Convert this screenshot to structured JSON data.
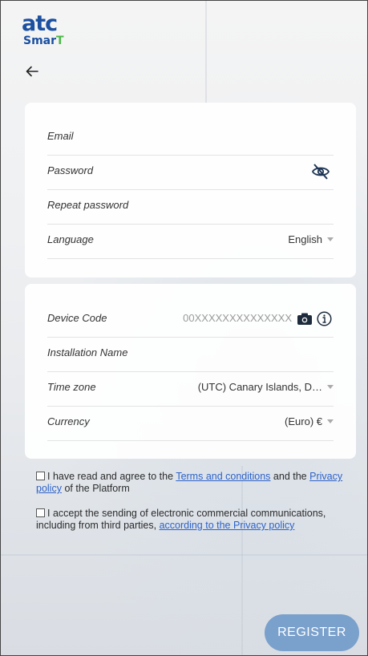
{
  "logo": {
    "atc": "atc",
    "smart_part1": "Smar",
    "smart_part2": "T",
    "brand_color": "#1b4fa0",
    "accent_color": "#4cb848"
  },
  "account_form": {
    "email_label": "Email",
    "password_label": "Password",
    "password_icon": "eye-slash-icon",
    "repeat_password_label": "Repeat password",
    "language_label": "Language",
    "language_value": "English"
  },
  "installation_form": {
    "device_code_label": "Device Code",
    "device_code_placeholder": "00XXXXXXXXXXXXXX",
    "camera_icon": "camera-icon",
    "info_icon": "info-icon",
    "installation_name_label": "Installation Name",
    "timezone_label": "Time zone",
    "timezone_value": "(UTC) Canary Islands, D…",
    "currency_label": "Currency",
    "currency_value": "(Euro) €"
  },
  "consents": {
    "terms_prefix": "I have read and agree to the",
    "terms_link": "Terms and conditions",
    "terms_mid": "and the",
    "privacy_link": "Privacy policy",
    "terms_suffix": "of the Platform",
    "comms_text": "I accept the sending of electronic commercial communications, including from third parties,",
    "comms_link": "according to the Privacy policy"
  },
  "register_button": {
    "label": "REGISTER",
    "color": "#7aa0cc"
  }
}
